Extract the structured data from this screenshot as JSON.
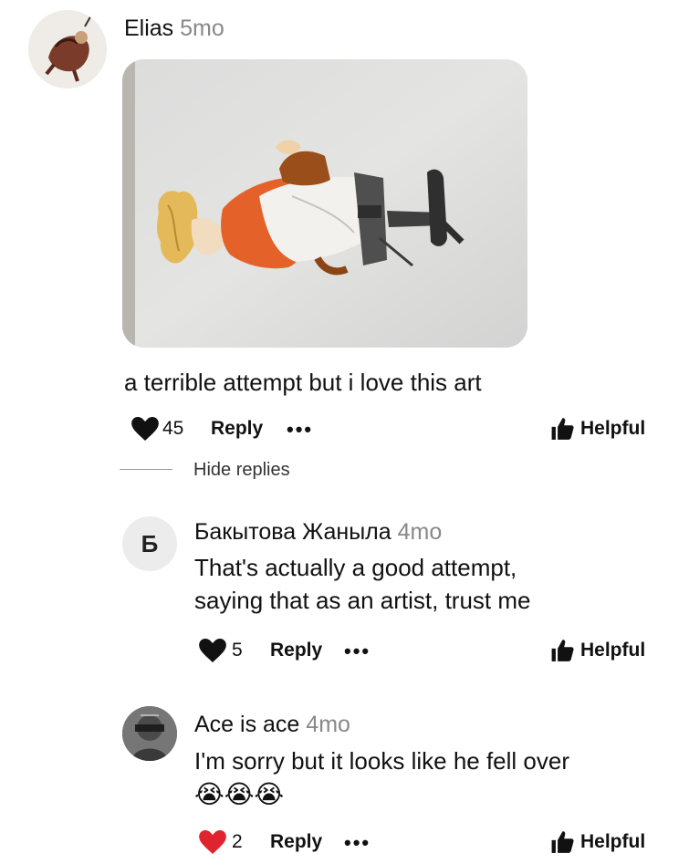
{
  "post": {
    "author": "Elias",
    "time": "5mo",
    "text": "a terrible attempt but i love this art",
    "likes": "45",
    "reply_label": "Reply",
    "more_label": "•••",
    "helpful_label": "Helpful",
    "liked": false
  },
  "thread": {
    "hide_replies_label": "Hide replies"
  },
  "replies": [
    {
      "avatar_letter": "Б",
      "author": "Бакытова Жаныла",
      "time": "4mo",
      "text_line1": "That's actually a good attempt,",
      "text_line2": "saying that as an artist, trust me",
      "likes": "5",
      "reply_label": "Reply",
      "more_label": "•••",
      "helpful_label": "Helpful",
      "liked": false
    },
    {
      "author": "Ace is ace",
      "time": "4mo",
      "text_line1": "I'm sorry but it looks like he fell over",
      "emoji": "😭😭😭",
      "likes": "2",
      "reply_label": "Reply",
      "more_label": "•••",
      "helpful_label": "Helpful",
      "liked": true
    }
  ],
  "colors": {
    "liked_heart": "#e0242f",
    "heart": "#111111",
    "muted": "#888888"
  }
}
